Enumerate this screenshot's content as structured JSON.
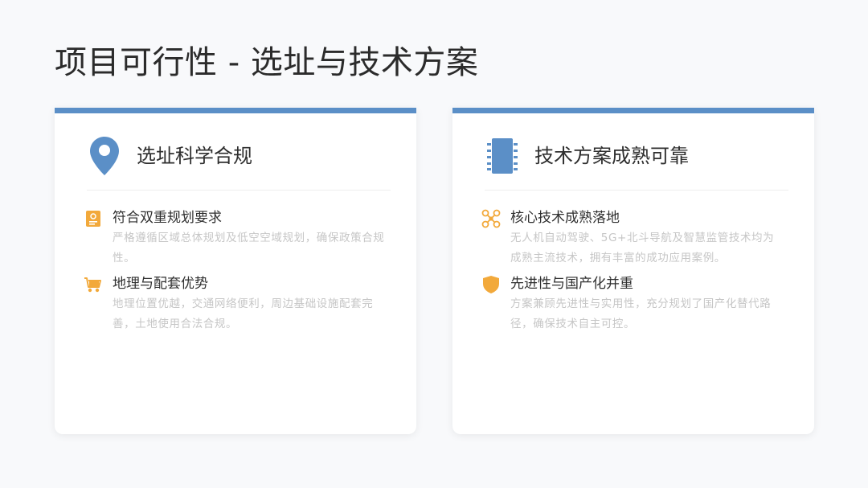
{
  "page": {
    "title": "项目可行性 - 选址与技术方案"
  },
  "colors": {
    "accent": "#5b8fc7",
    "icon_orange": "#f2a93b",
    "background": "#f8f9fb"
  },
  "cards": [
    {
      "icon": "location-pin-icon",
      "title": "选址科学合规",
      "items": [
        {
          "icon": "document-icon",
          "title": "符合双重规划要求",
          "desc": "严格遵循区域总体规划及低空空域规划，确保政策合规性。"
        },
        {
          "icon": "cart-icon",
          "title": "地理与配套优势",
          "desc": "地理位置优越，交通网络便利，周边基础设施配套完善，土地使用合法合规。"
        }
      ]
    },
    {
      "icon": "chip-icon",
      "title": "技术方案成熟可靠",
      "items": [
        {
          "icon": "drone-icon",
          "title": "核心技术成熟落地",
          "desc": "无人机自动驾驶、5G+北斗导航及智慧监管技术均为成熟主流技术，拥有丰富的成功应用案例。"
        },
        {
          "icon": "shield-icon",
          "title": "先进性与国产化并重",
          "desc": "方案兼顾先进性与实用性，充分规划了国产化替代路径，确保技术自主可控。"
        }
      ]
    }
  ]
}
